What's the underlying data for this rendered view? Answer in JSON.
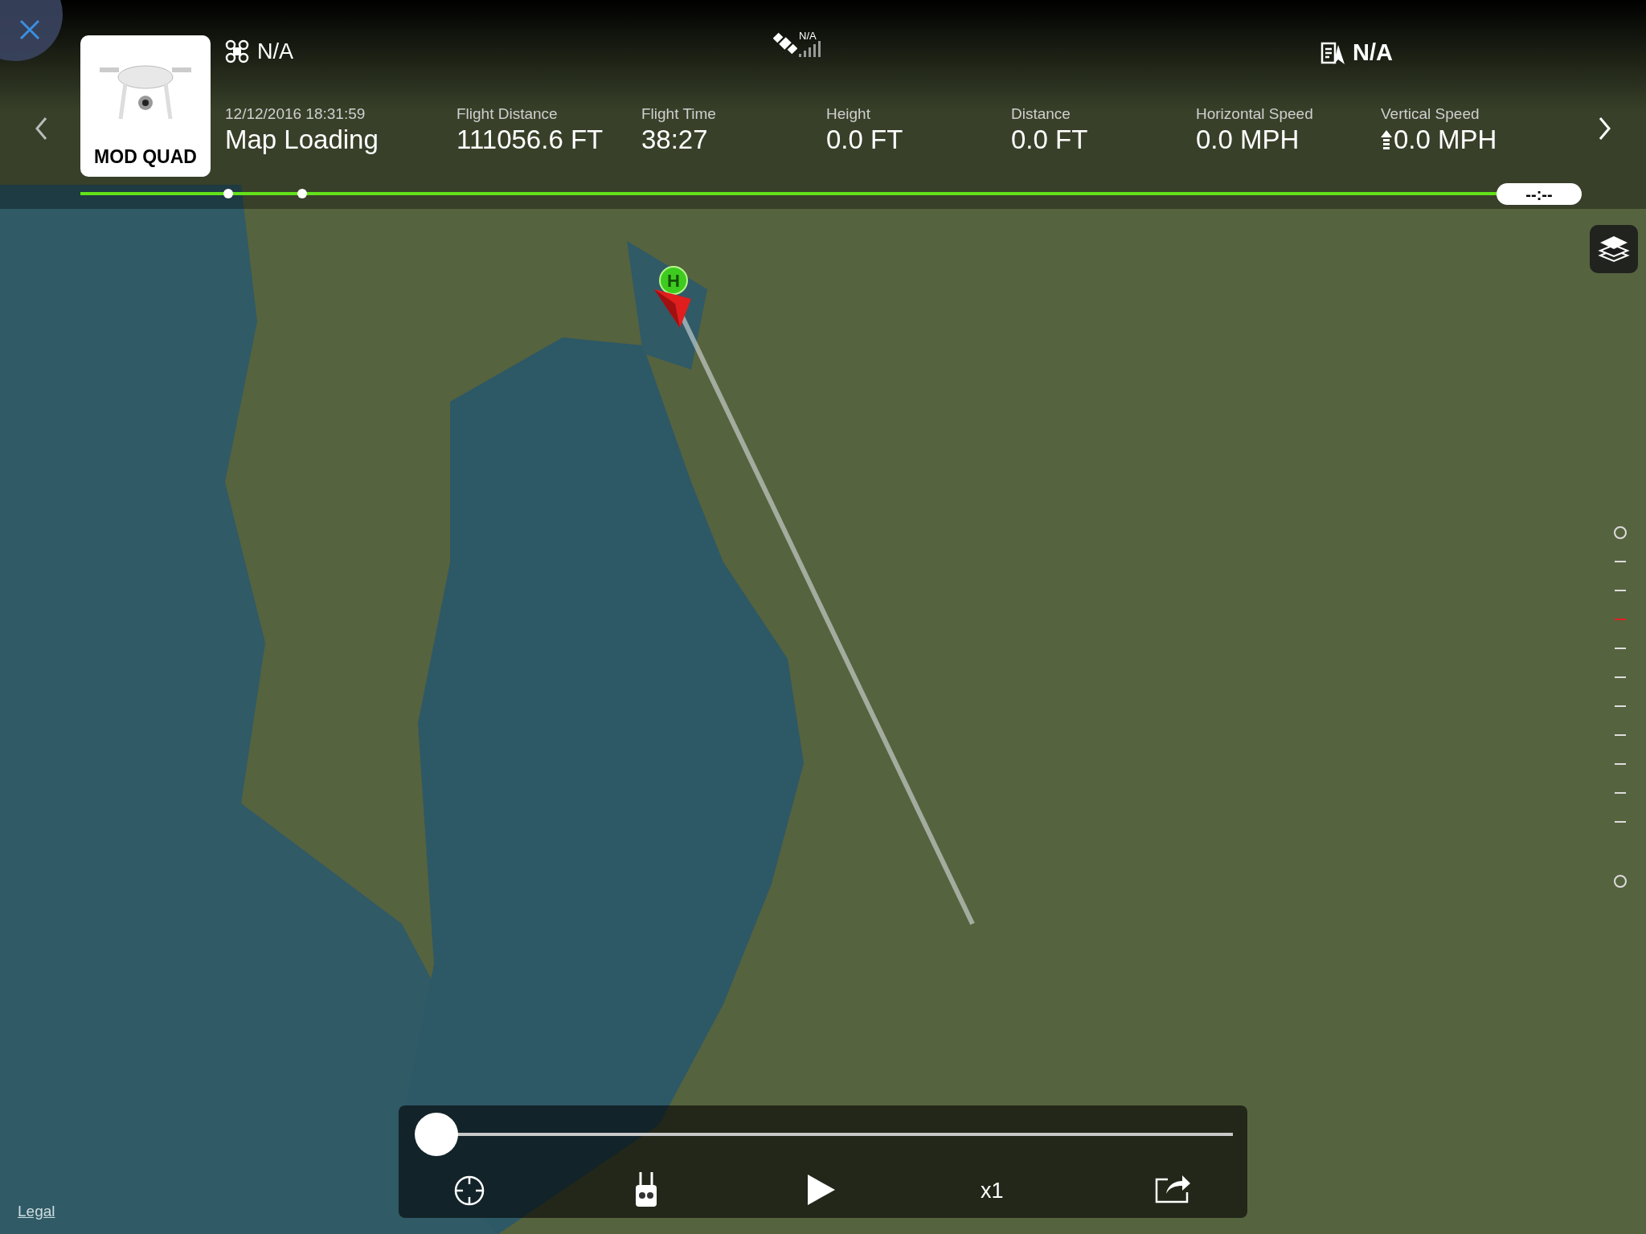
{
  "aircraft": {
    "name": "MOD QUAD",
    "battery": "N/A",
    "gps": "N/A",
    "flight_log_status": "N/A"
  },
  "flight": {
    "datetime": "12/12/2016 18:31:59",
    "location": "Map Loading"
  },
  "stats": [
    {
      "label": "Flight Distance",
      "value": "111056.6 FT",
      "kind": "plain"
    },
    {
      "label": "Flight Time",
      "value": "38:27",
      "kind": "plain"
    },
    {
      "label": "Height",
      "value": "0.0 FT",
      "kind": "plain"
    },
    {
      "label": "Distance",
      "value": "0.0 FT",
      "kind": "plain"
    },
    {
      "label": "Horizontal Speed",
      "value": "0.0 MPH",
      "kind": "plain"
    },
    {
      "label": "Vertical Speed",
      "value": "0.0 MPH",
      "kind": "vertical"
    }
  ],
  "timeline": {
    "time": "--:--"
  },
  "playback": {
    "level": 0,
    "speed": "x1"
  },
  "map": {
    "legal": "Legal",
    "home_label": "H"
  }
}
